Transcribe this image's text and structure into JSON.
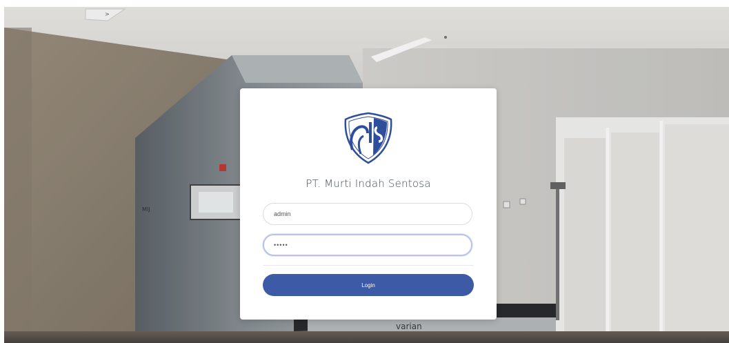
{
  "login": {
    "company_name": "PT. Murti Indah Sentosa",
    "username_value": "admin",
    "password_value": "•••••",
    "login_label": "Login"
  },
  "background": {
    "machine_label": "varian",
    "top_left_sign": ">"
  },
  "colors": {
    "button": "#3d5aa6",
    "logo_blue": "#2e4d9b",
    "focus_ring": "#b9c3ea"
  },
  "icons": {
    "logo": "company-shield-logo"
  }
}
